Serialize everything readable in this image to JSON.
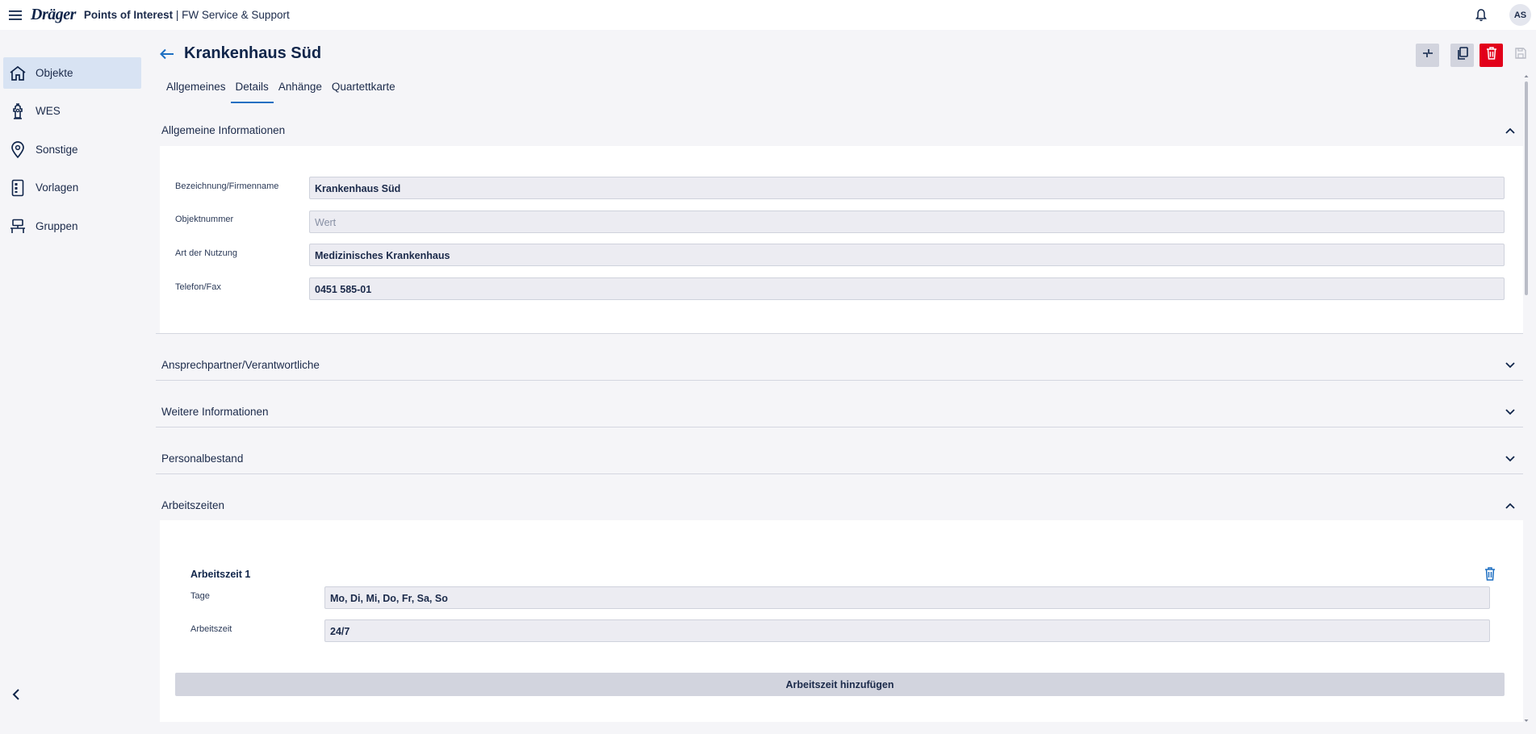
{
  "topbar": {
    "brand": "Dräger",
    "app_name": "Points of Interest",
    "app_subtitle": " | FW Service & Support",
    "avatar_initials": "AS"
  },
  "sidebar": {
    "items": [
      {
        "label": "Objekte",
        "icon": "home-icon",
        "active": true
      },
      {
        "label": "WES",
        "icon": "hydrant-icon",
        "active": false
      },
      {
        "label": "Sonstige",
        "icon": "location-pin-icon",
        "active": false
      },
      {
        "label": "Vorlagen",
        "icon": "template-icon",
        "active": false
      },
      {
        "label": "Gruppen",
        "icon": "groups-icon",
        "active": false
      }
    ]
  },
  "header": {
    "title": "Krankenhaus Süd"
  },
  "tabs": [
    {
      "label": "Allgemeines",
      "active": false
    },
    {
      "label": "Details",
      "active": true
    },
    {
      "label": "Anhänge",
      "active": false
    },
    {
      "label": "Quartettkarte",
      "active": false
    }
  ],
  "sections": {
    "general": {
      "title": "Allgemeine Informationen",
      "fields": [
        {
          "label": "Bezeichnung/Firmenname",
          "value": "Krankenhaus Süd",
          "placeholder": ""
        },
        {
          "label": "Objektnummer",
          "value": "",
          "placeholder": "Wert"
        },
        {
          "label": "Art der Nutzung",
          "value": "Medizinisches Krankenhaus",
          "placeholder": ""
        },
        {
          "label": "Telefon/Fax",
          "value": "0451 585-01",
          "placeholder": ""
        }
      ]
    },
    "contacts": {
      "title": "Ansprechpartner/Verantwortliche"
    },
    "further": {
      "title": "Weitere Informationen"
    },
    "staff": {
      "title": "Personalbestand"
    },
    "working_hours": {
      "title": "Arbeitszeiten",
      "entry_title": "Arbeitszeit 1",
      "fields": [
        {
          "label": "Tage",
          "value": "Mo, Di, Mi, Do, Fr, Sa, So"
        },
        {
          "label": "Arbeitszeit",
          "value": "24/7"
        }
      ],
      "add_label": "Arbeitszeit hinzufügen"
    }
  },
  "colors": {
    "accent": "#1d6fc2",
    "delete": "#e2001a",
    "active_nav": "#d8e3f3"
  }
}
